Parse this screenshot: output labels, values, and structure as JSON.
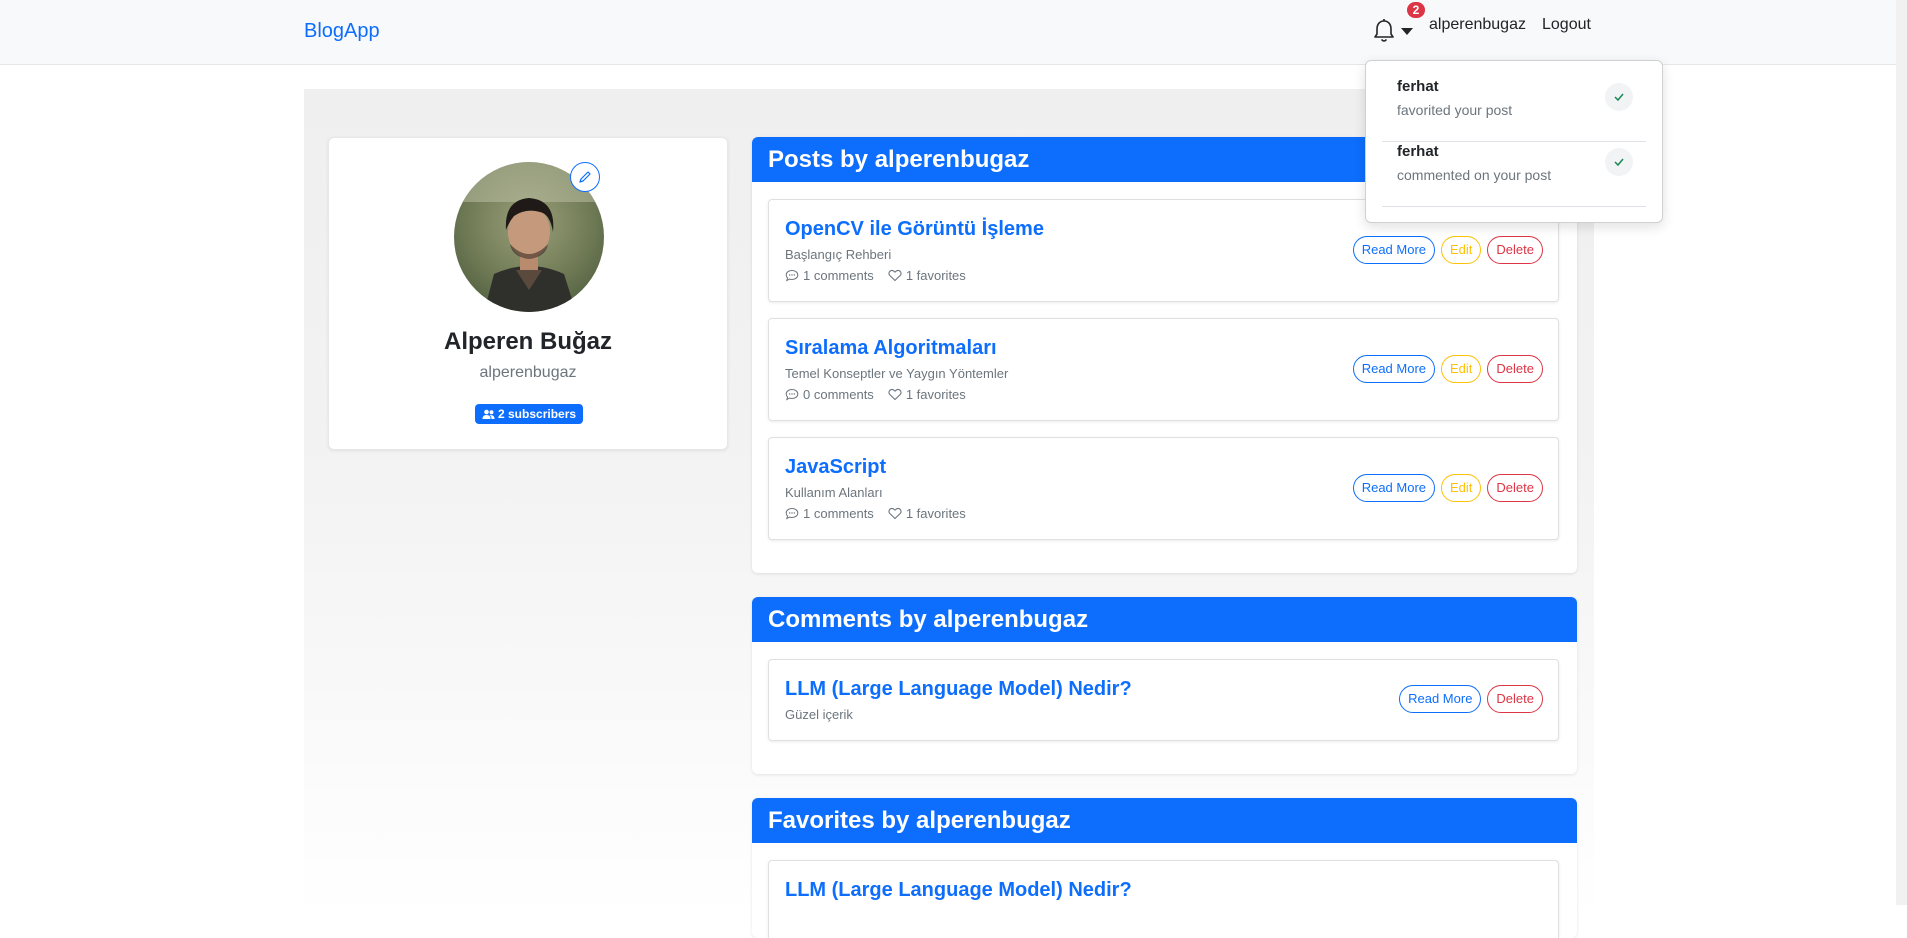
{
  "navbar": {
    "brand": "BlogApp",
    "notification_count": "2",
    "username": "alperenbugaz",
    "logout": "Logout"
  },
  "notifications": [
    {
      "user": "ferhat",
      "text": "favorited your post"
    },
    {
      "user": "ferhat",
      "text": "commented on your post"
    }
  ],
  "profile": {
    "name": "Alperen Buğaz",
    "username": "alperenbugaz",
    "subscribers": "2 subscribers"
  },
  "posts_section": {
    "title": "Posts by alperenbugaz",
    "items": [
      {
        "title": "OpenCV ile Görüntü İşleme",
        "subtitle": "Başlangıç Rehberi",
        "comments": "1 comments",
        "favorites": "1 favorites"
      },
      {
        "title": "Sıralama Algoritmaları",
        "subtitle": "Temel Konseptler ve Yaygın Yöntemler",
        "comments": "0 comments",
        "favorites": "1 favorites"
      },
      {
        "title": "JavaScript",
        "subtitle": "Kullanım Alanları",
        "comments": "1 comments",
        "favorites": "1 favorites"
      }
    ]
  },
  "comments_section": {
    "title": "Comments by alperenbugaz",
    "items": [
      {
        "title": "LLM (Large Language Model) Nedir?",
        "subtitle": "Güzel içerik"
      }
    ]
  },
  "favorites_section": {
    "title": "Favorites by alperenbugaz",
    "items": [
      {
        "title": "LLM (Large Language Model) Nedir?"
      }
    ]
  },
  "buttons": {
    "read_more": "Read More",
    "edit": "Edit",
    "delete": "Delete"
  },
  "icons": {
    "bell": "bell-icon",
    "comment": "chat-bubble-icon",
    "favorite": "heart-icon",
    "check": "check-icon",
    "edit_avatar": "pencil-icon",
    "subscribers": "people-icon"
  },
  "colors": {
    "primary": "#0d6efd",
    "warning": "#ffc107",
    "danger": "#dc3545",
    "muted": "#6c757d"
  }
}
